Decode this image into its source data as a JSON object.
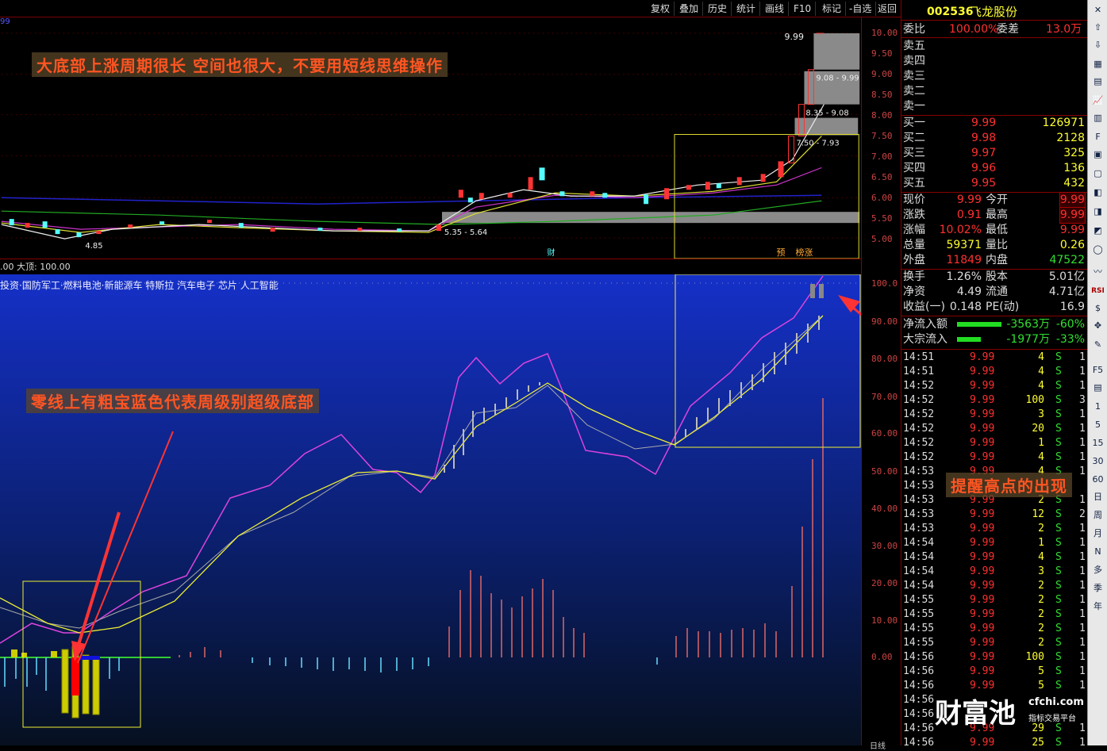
{
  "toolbar_top": {
    "items": [
      "复权",
      "叠加",
      "历史",
      "统计",
      "画线",
      "F10",
      "标记",
      "-自选",
      "返回"
    ]
  },
  "stock": {
    "code": "002536",
    "name": "飞龙股份"
  },
  "quote": {
    "wb_label": "委比",
    "wb_val": "100.00%",
    "wc_label": "委差",
    "wc_val": "13.0万",
    "sell": [
      {
        "label": "卖五"
      },
      {
        "label": "卖四"
      },
      {
        "label": "卖三"
      },
      {
        "label": "卖二"
      },
      {
        "label": "卖一"
      }
    ],
    "buy": [
      {
        "label": "买一",
        "price": "9.99",
        "vol": "126971"
      },
      {
        "label": "买二",
        "price": "9.98",
        "vol": "2128"
      },
      {
        "label": "买三",
        "price": "9.97",
        "vol": "325"
      },
      {
        "label": "买四",
        "price": "9.96",
        "vol": "136"
      },
      {
        "label": "买五",
        "price": "9.95",
        "vol": "432"
      }
    ],
    "stats": [
      {
        "l1": "现价",
        "v1": "9.99",
        "l2": "今开",
        "v2": "9.99"
      },
      {
        "l1": "涨跌",
        "v1": "0.91",
        "l2": "最高",
        "v2": "9.99"
      },
      {
        "l1": "涨幅",
        "v1": "10.02%",
        "l2": "最低",
        "v2": "9.99"
      },
      {
        "l1": "总量",
        "v1": "59371",
        "l2": "量比",
        "v2": "0.26"
      },
      {
        "l1": "外盘",
        "v1": "11849",
        "l2": "内盘",
        "v2": "47522"
      }
    ],
    "stats2": [
      {
        "l1": "换手",
        "v1": "1.26%",
        "l2": "股本",
        "v2": "5.01亿"
      },
      {
        "l1": "净资",
        "v1": "4.49",
        "l2": "流通",
        "v2": "4.71亿"
      },
      {
        "l1": "收益(一)",
        "v1": "0.148",
        "l2": "PE(动)",
        "v2": "16.9"
      }
    ],
    "flow": [
      {
        "label": "净流入额",
        "val": "-3563万",
        "pct": "-60%"
      },
      {
        "label": "大宗流入",
        "val": "-1977万",
        "pct": "-33%"
      }
    ]
  },
  "ticks": [
    {
      "t": "14:51",
      "p": "9.99",
      "v": "4",
      "s": "S",
      "n": "1"
    },
    {
      "t": "14:51",
      "p": "9.99",
      "v": "4",
      "s": "S",
      "n": "1"
    },
    {
      "t": "14:52",
      "p": "9.99",
      "v": "4",
      "s": "S",
      "n": "1"
    },
    {
      "t": "14:52",
      "p": "9.99",
      "v": "100",
      "s": "S",
      "n": "3"
    },
    {
      "t": "14:52",
      "p": "9.99",
      "v": "3",
      "s": "S",
      "n": "1"
    },
    {
      "t": "14:52",
      "p": "9.99",
      "v": "20",
      "s": "S",
      "n": "1"
    },
    {
      "t": "14:52",
      "p": "9.99",
      "v": "1",
      "s": "S",
      "n": "1"
    },
    {
      "t": "14:52",
      "p": "9.99",
      "v": "4",
      "s": "S",
      "n": "1"
    },
    {
      "t": "14:53",
      "p": "9.99",
      "v": "4",
      "s": "S",
      "n": "1"
    },
    {
      "t": "14:53",
      "p": "",
      "v": "",
      "s": "",
      "n": ""
    },
    {
      "t": "14:53",
      "p": "9.99",
      "v": "2",
      "s": "S",
      "n": "1"
    },
    {
      "t": "14:53",
      "p": "9.99",
      "v": "12",
      "s": "S",
      "n": "2"
    },
    {
      "t": "14:53",
      "p": "9.99",
      "v": "2",
      "s": "S",
      "n": "1"
    },
    {
      "t": "14:54",
      "p": "9.99",
      "v": "1",
      "s": "S",
      "n": "1"
    },
    {
      "t": "14:54",
      "p": "9.99",
      "v": "4",
      "s": "S",
      "n": "1"
    },
    {
      "t": "14:54",
      "p": "9.99",
      "v": "3",
      "s": "S",
      "n": "1"
    },
    {
      "t": "14:54",
      "p": "9.99",
      "v": "2",
      "s": "S",
      "n": "1"
    },
    {
      "t": "14:55",
      "p": "9.99",
      "v": "2",
      "s": "S",
      "n": "1"
    },
    {
      "t": "14:55",
      "p": "9.99",
      "v": "2",
      "s": "S",
      "n": "1"
    },
    {
      "t": "14:55",
      "p": "9.99",
      "v": "2",
      "s": "S",
      "n": "1"
    },
    {
      "t": "14:55",
      "p": "9.99",
      "v": "2",
      "s": "S",
      "n": "1"
    },
    {
      "t": "14:56",
      "p": "9.99",
      "v": "100",
      "s": "S",
      "n": "1"
    },
    {
      "t": "14:56",
      "p": "9.99",
      "v": "5",
      "s": "S",
      "n": "1"
    },
    {
      "t": "14:56",
      "p": "9.99",
      "v": "5",
      "s": "S",
      "n": "1"
    },
    {
      "t": "14:56",
      "p": "",
      "v": "",
      "s": "",
      "n": ""
    },
    {
      "t": "14:56",
      "p": "",
      "v": "",
      "s": "",
      "n": ""
    },
    {
      "t": "14:56",
      "p": "9.99",
      "v": "29",
      "s": "S",
      "n": "1"
    },
    {
      "t": "14:56",
      "p": "9.99",
      "v": "25",
      "s": "S",
      "n": "1"
    }
  ],
  "price_axis": [
    "10.00",
    "9.50",
    "9.00",
    "8.50",
    "8.00",
    "7.50",
    "7.00",
    "6.50",
    "6.00",
    "5.50",
    "5.00"
  ],
  "ind_axis": [
    "100.0",
    "90.00",
    "80.00",
    "70.00",
    "60.00",
    "50.00",
    "40.00",
    "30.00",
    "20.00",
    "10.00",
    "0.00"
  ],
  "chart_labels": {
    "high": "9.99",
    "r1": "9.08 - 9.99",
    "r2": "8.35 - 9.08",
    "r3": "7.50 - 7.93",
    "low_range": "5.35 - 5.64",
    "low": "4.85",
    "cai": "财",
    "yu": "预",
    "bang": "榜涨",
    "sub_header": ".00  大顶: 100.00",
    "concepts": "投资·国防军工·燃料电池·新能源车 特斯拉 汽车电子 芯片 人工智能",
    "top_left": "99"
  },
  "annotations": {
    "a1": "大底部上涨周期很长     空间也很大，不要用短线思维操作",
    "a2": "零线上有粗宝蓝色代表周级别超级底部",
    "a3": "提醒高点的出现"
  },
  "watermark": {
    "brand": "财富池",
    "url": "cfchi.com",
    "tag": "指标交易平台"
  },
  "side_tools": [
    "日",
    "周",
    "月",
    "N",
    "多",
    "季",
    "年"
  ],
  "side_nums": [
    "1",
    "5",
    "15",
    "30",
    "60"
  ],
  "side_bottom": "日线"
}
